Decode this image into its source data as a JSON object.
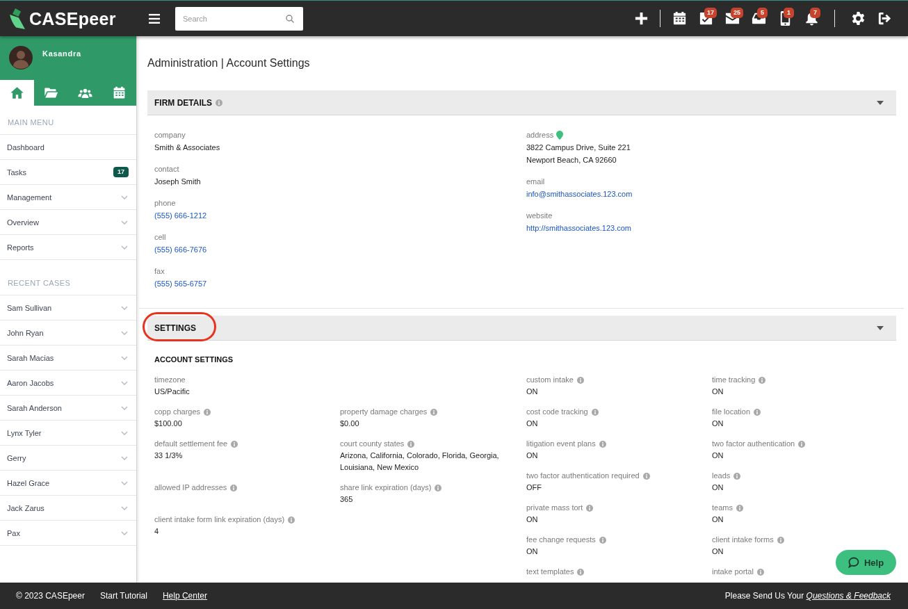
{
  "top_bar": {
    "logo": "CASEpeer",
    "search": {
      "placeholder": "Search"
    },
    "tool_groups": [
      [
        {
          "kind": "add"
        }
      ],
      [
        {
          "kind": "calendar"
        },
        {
          "kind": "tasks",
          "badge": "17"
        },
        {
          "kind": "mail",
          "badge": "25"
        },
        {
          "kind": "inbox",
          "badge": "5"
        },
        {
          "kind": "phone",
          "badge": "1"
        },
        {
          "kind": "notifications",
          "badge": "7"
        }
      ],
      [
        {
          "kind": "settings"
        },
        {
          "kind": "logout"
        }
      ]
    ]
  },
  "sidebar": {
    "user": {
      "name": "Kasandra"
    },
    "tabs": [
      {
        "kind": "home",
        "selected": true
      },
      {
        "kind": "cases",
        "selected": false
      },
      {
        "kind": "contacts",
        "selected": false
      },
      {
        "kind": "calendar",
        "selected": false
      }
    ],
    "sections": [
      {
        "title": "MAIN MENU",
        "items": [
          {
            "label": "Dashboard",
            "expandable": false
          },
          {
            "label": "Tasks",
            "badge": "17",
            "expandable": false
          },
          {
            "label": "Management",
            "expandable": true
          },
          {
            "label": "Overview",
            "expandable": true
          },
          {
            "label": "Reports",
            "expandable": true
          }
        ]
      },
      {
        "title": "RECENT CASES",
        "items": [
          {
            "label": "Sam Sullivan",
            "expandable": true
          },
          {
            "label": "John Ryan",
            "expandable": true
          },
          {
            "label": "Sarah Macias",
            "expandable": true
          },
          {
            "label": "Aaron Jacobs",
            "expandable": true
          },
          {
            "label": "Sarah Anderson",
            "expandable": true
          },
          {
            "label": "Lynx Tyler",
            "expandable": true
          },
          {
            "label": "Gerry",
            "expandable": true
          },
          {
            "label": "Hazel Grace",
            "expandable": true
          },
          {
            "label": "Jack Zarus",
            "expandable": true
          },
          {
            "label": "Pax",
            "expandable": true
          }
        ]
      }
    ]
  },
  "main": {
    "title": "Administration | Account Settings",
    "firm_details": {
      "title": "FIRM DETAILS",
      "info": true,
      "expanded": true,
      "columns": [
        [
          {
            "kind": "text",
            "label": "company",
            "value": "Smith & Associates"
          },
          {
            "kind": "text",
            "label": "contact",
            "value": "Joseph Smith"
          },
          {
            "kind": "link",
            "label": "phone",
            "value": "(555) 666-1212"
          },
          {
            "kind": "link",
            "label": "cell",
            "value": "(555) 666-7676"
          },
          {
            "kind": "link",
            "label": "fax",
            "value": "(555) 565-6757"
          }
        ],
        [
          {
            "kind": "address",
            "label": "address",
            "lines": [
              "3822 Campus Drive, Suite 221",
              "Newport Beach, CA 92660"
            ]
          },
          {
            "kind": "link",
            "label": "email",
            "value": "info@smithassociates.123.com"
          },
          {
            "kind": "link",
            "label": "website",
            "value": "http://smithassociates.123.com"
          }
        ]
      ]
    },
    "settings": {
      "title": "SETTINGS",
      "expanded": true,
      "highlighted": true,
      "subtitle": "ACCOUNT SETTINGS",
      "left_rows": [
        {
          "cells": [
            {
              "label": "timezone",
              "info": false,
              "value": "US/Pacific"
            }
          ]
        },
        {
          "cells": [
            {
              "label": "copp charges",
              "info": true,
              "value": "$100.00"
            },
            {
              "label": "property damage charges",
              "info": true,
              "value": "$0.00"
            }
          ]
        },
        {
          "cells": [
            {
              "label": "default settlement fee",
              "info": true,
              "value": "33 1/3%"
            },
            {
              "label": "court county states",
              "info": true,
              "value": "Arizona, California, Colorado, Florida, Georgia, Louisiana, New Mexico"
            }
          ]
        },
        {
          "cells": [
            {
              "label": "allowed IP addresses",
              "info": true
            },
            {
              "label": "share link expiration (days)",
              "info": true,
              "value": "365"
            }
          ]
        },
        {
          "cells": [
            {
              "label": "client intake form link expiration (days)",
              "info": true,
              "value": "4"
            }
          ]
        }
      ],
      "right_rows": [
        {
          "cells": [
            {
              "label": "custom intake",
              "info": true,
              "value": "ON"
            },
            {
              "label": "time tracking",
              "info": true,
              "value": "ON"
            }
          ]
        },
        {
          "cells": [
            {
              "label": "cost code tracking",
              "info": true,
              "value": "ON"
            },
            {
              "label": "file location",
              "info": true,
              "value": "ON"
            }
          ]
        },
        {
          "cells": [
            {
              "label": "litigation event plans",
              "info": true,
              "value": "ON"
            },
            {
              "label": "two factor authentication",
              "info": true,
              "value": "ON"
            }
          ]
        },
        {
          "cells": [
            {
              "label": "two factor authentication required",
              "info": true,
              "value": "OFF"
            },
            {
              "label": "leads",
              "info": true,
              "value": "ON"
            }
          ]
        },
        {
          "cells": [
            {
              "label": "private mass tort",
              "info": true,
              "value": "ON"
            },
            {
              "label": "teams",
              "info": true,
              "value": "ON"
            }
          ]
        },
        {
          "cells": [
            {
              "label": "fee change requests",
              "info": true,
              "value": "ON"
            },
            {
              "label": "client intake forms",
              "info": true,
              "value": "ON"
            }
          ]
        },
        {
          "cells": [
            {
              "label": "text templates",
              "info": true
            },
            {
              "label": "intake portal",
              "info": true
            }
          ]
        }
      ]
    }
  },
  "help_button": {
    "label": "Help"
  },
  "footer": {
    "items": [
      {
        "kind": "text",
        "text": "© 2023 CASEpeer"
      },
      {
        "kind": "link",
        "text": "Start Tutorial"
      },
      {
        "kind": "underlined_link",
        "text": "Help Center"
      }
    ],
    "feedback": {
      "text": "Please Send Us Your",
      "link": "Questions & Feedback"
    }
  }
}
